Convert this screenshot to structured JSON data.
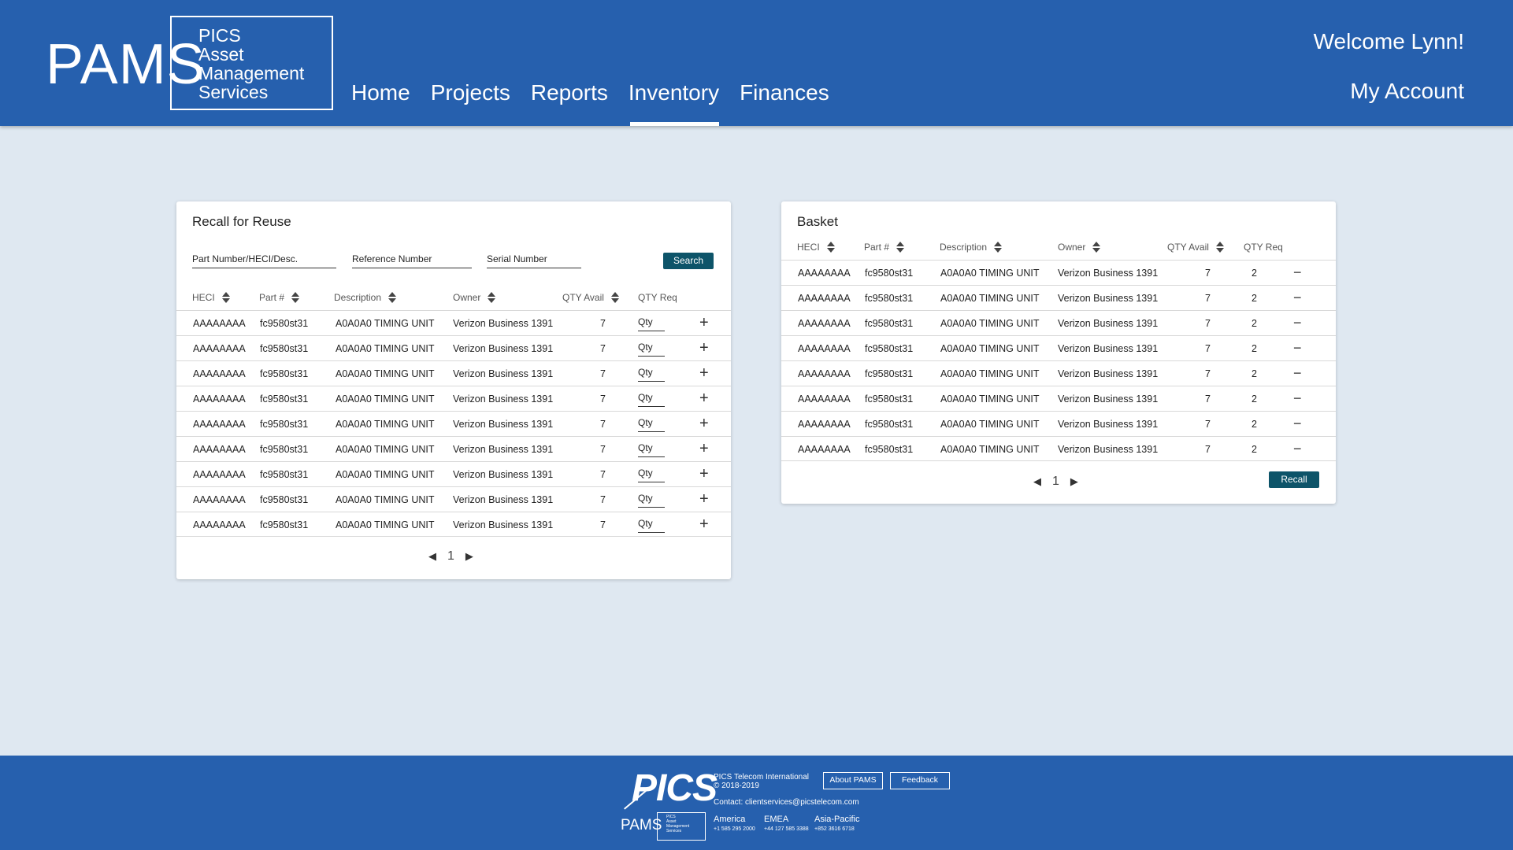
{
  "header": {
    "logo_text": "PAMS",
    "logo_subtitle": [
      "PICS",
      "Asset",
      "Management",
      "Services"
    ],
    "nav": [
      "Home",
      "Projects",
      "Reports",
      "Inventory",
      "Finances"
    ],
    "active_nav": "Inventory",
    "welcome": "Welcome Lynn!",
    "account": "My Account"
  },
  "recall": {
    "title": "Recall for Reuse",
    "filters": [
      "Part Number/HECI/Desc.",
      "Reference Number",
      "Serial Number"
    ],
    "search_label": "Search",
    "columns": [
      "HECI",
      "Part #",
      "Description",
      "Owner",
      "QTY Avail",
      "QTY Req"
    ],
    "qty_placeholder": "Qty",
    "rows": [
      [
        "AAAAAAAA",
        "fc9580st31",
        "A0A0A0 TIMING UNIT",
        "Verizon Business 1391",
        "7"
      ],
      [
        "AAAAAAAA",
        "fc9580st31",
        "A0A0A0 TIMING UNIT",
        "Verizon Business 1391",
        "7"
      ],
      [
        "AAAAAAAA",
        "fc9580st31",
        "A0A0A0 TIMING UNIT",
        "Verizon Business 1391",
        "7"
      ],
      [
        "AAAAAAAA",
        "fc9580st31",
        "A0A0A0 TIMING UNIT",
        "Verizon Business 1391",
        "7"
      ],
      [
        "AAAAAAAA",
        "fc9580st31",
        "A0A0A0 TIMING UNIT",
        "Verizon Business 1391",
        "7"
      ],
      [
        "AAAAAAAA",
        "fc9580st31",
        "A0A0A0 TIMING UNIT",
        "Verizon Business 1391",
        "7"
      ],
      [
        "AAAAAAAA",
        "fc9580st31",
        "A0A0A0 TIMING UNIT",
        "Verizon Business 1391",
        "7"
      ],
      [
        "AAAAAAAA",
        "fc9580st31",
        "A0A0A0 TIMING UNIT",
        "Verizon Business 1391",
        "7"
      ],
      [
        "AAAAAAAA",
        "fc9580st31",
        "A0A0A0 TIMING UNIT",
        "Verizon Business 1391",
        "7"
      ]
    ],
    "page": "1"
  },
  "basket": {
    "title": "Basket",
    "columns": [
      "HECI",
      "Part #",
      "Description",
      "Owner",
      "QTY Avail",
      "QTY Req"
    ],
    "rows": [
      [
        "AAAAAAAA",
        "fc9580st31",
        "A0A0A0 TIMING UNIT",
        "Verizon Business 1391",
        "7",
        "2"
      ],
      [
        "AAAAAAAA",
        "fc9580st31",
        "A0A0A0 TIMING UNIT",
        "Verizon Business 1391",
        "7",
        "2"
      ],
      [
        "AAAAAAAA",
        "fc9580st31",
        "A0A0A0 TIMING UNIT",
        "Verizon Business 1391",
        "7",
        "2"
      ],
      [
        "AAAAAAAA",
        "fc9580st31",
        "A0A0A0 TIMING UNIT",
        "Verizon Business 1391",
        "7",
        "2"
      ],
      [
        "AAAAAAAA",
        "fc9580st31",
        "A0A0A0 TIMING UNIT",
        "Verizon Business 1391",
        "7",
        "2"
      ],
      [
        "AAAAAAAA",
        "fc9580st31",
        "A0A0A0 TIMING UNIT",
        "Verizon Business 1391",
        "7",
        "2"
      ],
      [
        "AAAAAAAA",
        "fc9580st31",
        "A0A0A0 TIMING UNIT",
        "Verizon Business 1391",
        "7",
        "2"
      ],
      [
        "AAAAAAAA",
        "fc9580st31",
        "A0A0A0 TIMING UNIT",
        "Verizon Business 1391",
        "7",
        "2"
      ]
    ],
    "page": "1",
    "recall_label": "Recall"
  },
  "footer": {
    "pics_logo": "PICS",
    "company": "PICS Telecom International",
    "copyright": "© 2018-2019",
    "about_label": "About PAMS",
    "feedback_label": "Feedback",
    "contact": "Contact: clientservices@picstelecom.com",
    "pams_logo": "PAMS",
    "pams_subtitle": [
      "PICS",
      "Asset",
      "Management",
      "Services"
    ],
    "regions": [
      {
        "name": "America",
        "phone": "+1 585 295 2000"
      },
      {
        "name": "EMEA",
        "phone": "+44 127 585 3388"
      },
      {
        "name": "Asia-Pacific",
        "phone": "+852 3616 6718"
      }
    ]
  },
  "icons": {
    "add": "+",
    "remove": "−",
    "prev": "◀",
    "next": "▶"
  },
  "colors": {
    "brand_blue": "#2660ae",
    "button_teal": "#0d5469",
    "page_bg": "#dfe8f1"
  }
}
